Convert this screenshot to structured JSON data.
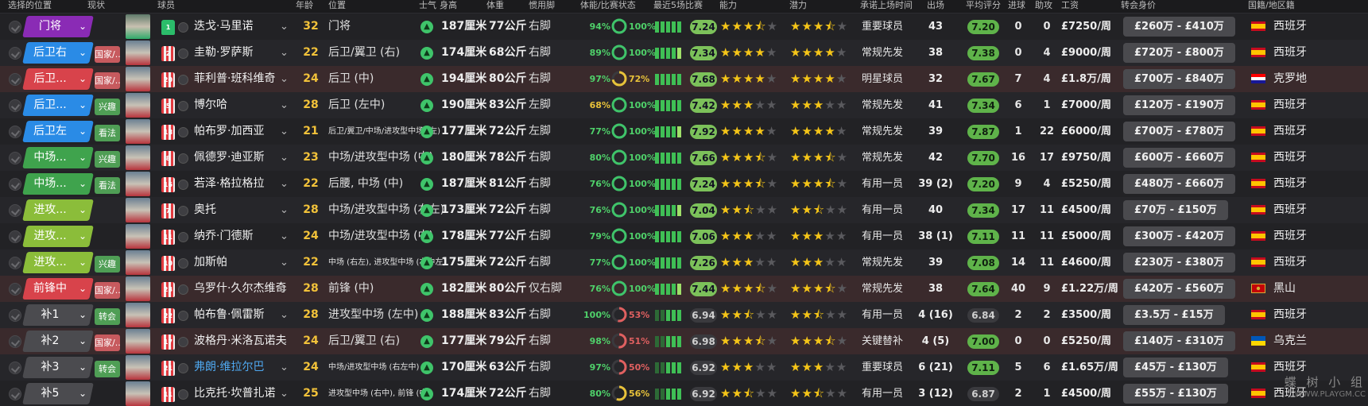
{
  "header": {
    "cols": [
      "选择的位置",
      "现状",
      "球员",
      "年龄",
      "位置",
      "士气",
      "身高",
      "体重",
      "惯用脚",
      "体能/比赛状态",
      "最近5场比赛",
      "能力",
      "潜力",
      "承诺上场时间",
      "出场",
      "平均评分",
      "进球",
      "助攻",
      "工资",
      "转会身价",
      "国籍/地区籍"
    ]
  },
  "rows": [
    {
      "pos": "门将",
      "pc": "gk",
      "role": "",
      "rc": "",
      "name": "迭戈·马里诺",
      "shirt": "1",
      "age": "32",
      "ppos": "门将",
      "psm": false,
      "height": "187厘米",
      "weight": "77公斤",
      "foot": "右脚",
      "fit": "94%",
      "fit_y": false,
      "sharp": "100%",
      "sharp_c": "g",
      "ring": 1.0,
      "rcol": "#3fc46a",
      "rating": "7.24",
      "rgrey": false,
      "ability": 3.5,
      "potential": 3.5,
      "status": "重要球员",
      "apps": "43",
      "avg": "7.20",
      "agrey": false,
      "goals": "0",
      "assists": "0",
      "wage": "£7250/周",
      "value": "£260万 - £410万",
      "flag": "es",
      "nat": "西班牙"
    },
    {
      "pos": "后卫右",
      "pc": "def",
      "role": "国家/...",
      "rc": "red",
      "name": "圭勒·罗萨斯",
      "shirt": "2",
      "age": "22",
      "ppos": "后卫/翼卫 (右)",
      "psm": false,
      "height": "174厘米",
      "weight": "68公斤",
      "foot": "右脚",
      "fit": "89%",
      "fit_y": false,
      "sharp": "100%",
      "sharp_c": "g",
      "ring": 1.0,
      "rcol": "#3fc46a",
      "rating": "7.34",
      "rgrey": false,
      "ability": 4,
      "potential": 4,
      "status": "常规先发",
      "apps": "38",
      "avg": "7.38",
      "agrey": false,
      "goals": "0",
      "assists": "4",
      "wage": "£9000/周",
      "value": "£720万 - £800万",
      "flag": "es",
      "nat": "西班牙"
    },
    {
      "pos": "后卫...",
      "pc": "st",
      "role": "国家/...",
      "rc": "red",
      "name": "菲利普·班科维奇",
      "shirt": "20",
      "age": "24",
      "ppos": "后卫 (中)",
      "psm": false,
      "height": "194厘米",
      "weight": "80公斤",
      "foot": "右脚",
      "fit": "97%",
      "fit_y": false,
      "sharp": "72%",
      "sharp_c": "y",
      "ring": 0.72,
      "rcol": "#e8c23a",
      "rating": "7.68",
      "rgrey": false,
      "ability": 4,
      "potential": 4,
      "status": "明星球员",
      "apps": "32",
      "avg": "7.67",
      "agrey": false,
      "goals": "7",
      "assists": "4",
      "wage": "£1.8万/周",
      "value": "£700万 - £840万",
      "flag": "hr",
      "nat": "克罗地"
    },
    {
      "pos": "后卫...",
      "pc": "def",
      "role": "兴趣",
      "rc": "green",
      "name": "博尔哈",
      "shirt": "5",
      "age": "28",
      "ppos": "后卫 (左中)",
      "psm": false,
      "height": "190厘米",
      "weight": "83公斤",
      "foot": "左脚",
      "fit": "68%",
      "fit_y": true,
      "sharp": "100%",
      "sharp_c": "g",
      "ring": 1.0,
      "rcol": "#3fc46a",
      "rating": "7.42",
      "rgrey": false,
      "ability": 3,
      "potential": 3,
      "status": "常规先发",
      "apps": "41",
      "avg": "7.34",
      "agrey": false,
      "goals": "6",
      "assists": "1",
      "wage": "£7000/周",
      "value": "£120万 - £190万",
      "flag": "es",
      "nat": "西班牙"
    },
    {
      "pos": "后卫左",
      "pc": "def",
      "role": "看法",
      "rc": "green",
      "name": "帕布罗·加西亚",
      "shirt": "18",
      "age": "21",
      "ppos": "后卫/翼卫/中场/进攻型中场 (左)",
      "psm": true,
      "height": "177厘米",
      "weight": "72公斤",
      "foot": "左脚",
      "fit": "77%",
      "fit_y": false,
      "sharp": "100%",
      "sharp_c": "g",
      "ring": 1.0,
      "rcol": "#3fc46a",
      "rating": "7.92",
      "rgrey": false,
      "ability": 4,
      "potential": 4,
      "status": "常规先发",
      "apps": "39",
      "avg": "7.87",
      "agrey": false,
      "goals": "1",
      "assists": "22",
      "wage": "£6000/周",
      "value": "£700万 - £780万",
      "flag": "es",
      "nat": "西班牙"
    },
    {
      "pos": "中场...",
      "pc": "mid",
      "role": "兴趣",
      "rc": "green",
      "name": "佩德罗·迪亚斯",
      "shirt": "8",
      "age": "23",
      "ppos": "中场/进攻型中场 (中)",
      "psm": false,
      "height": "180厘米",
      "weight": "78公斤",
      "foot": "右脚",
      "fit": "80%",
      "fit_y": false,
      "sharp": "100%",
      "sharp_c": "g",
      "ring": 1.0,
      "rcol": "#3fc46a",
      "rating": "7.66",
      "rgrey": false,
      "ability": 3.5,
      "potential": 3.5,
      "status": "常规先发",
      "apps": "42",
      "avg": "7.70",
      "agrey": false,
      "goals": "16",
      "assists": "17",
      "wage": "£9750/周",
      "value": "£600万 - £660万",
      "flag": "es",
      "nat": "西班牙"
    },
    {
      "pos": "中场...",
      "pc": "mid",
      "role": "看法",
      "rc": "green",
      "name": "若泽·格拉格拉",
      "shirt": "16",
      "age": "22",
      "ppos": "后腰, 中场 (中)",
      "psm": false,
      "height": "187厘米",
      "weight": "81公斤",
      "foot": "右脚",
      "fit": "76%",
      "fit_y": false,
      "sharp": "100%",
      "sharp_c": "g",
      "ring": 1.0,
      "rcol": "#3fc46a",
      "rating": "7.24",
      "rgrey": false,
      "ability": 3.5,
      "potential": 3.5,
      "status": "有用一员",
      "apps": "39 (2)",
      "avg": "7.20",
      "agrey": false,
      "goals": "9",
      "assists": "4",
      "wage": "£5250/周",
      "value": "£480万 - £660万",
      "flag": "es",
      "nat": "西班牙"
    },
    {
      "pos": "进攻...",
      "pc": "am",
      "role": "",
      "rc": "",
      "name": "奥托",
      "shirt": "7",
      "age": "28",
      "ppos": "中场/进攻型中场 (右左)",
      "psm": false,
      "height": "173厘米",
      "weight": "72公斤",
      "foot": "右脚",
      "fit": "76%",
      "fit_y": false,
      "sharp": "100%",
      "sharp_c": "g",
      "ring": 1.0,
      "rcol": "#3fc46a",
      "rating": "7.04",
      "rgrey": false,
      "ability": 2.5,
      "potential": 2.5,
      "status": "有用一员",
      "apps": "40",
      "avg": "7.34",
      "agrey": false,
      "goals": "17",
      "assists": "11",
      "wage": "£4500/周",
      "value": "£70万 - £150万",
      "flag": "es",
      "nat": "西班牙"
    },
    {
      "pos": "进攻...",
      "pc": "am",
      "role": "",
      "rc": "",
      "name": "纳乔·门德斯",
      "shirt": "11",
      "age": "24",
      "ppos": "中场/进攻型中场 (中)",
      "psm": false,
      "height": "178厘米",
      "weight": "77公斤",
      "foot": "右脚",
      "fit": "79%",
      "fit_y": false,
      "sharp": "100%",
      "sharp_c": "g",
      "ring": 1.0,
      "rcol": "#3fc46a",
      "rating": "7.06",
      "rgrey": false,
      "ability": 3,
      "potential": 3,
      "status": "有用一员",
      "apps": "38 (1)",
      "avg": "7.11",
      "agrey": false,
      "goals": "11",
      "assists": "11",
      "wage": "£5000/周",
      "value": "£300万 - £420万",
      "flag": "es",
      "nat": "西班牙"
    },
    {
      "pos": "进攻...",
      "pc": "am",
      "role": "兴趣",
      "rc": "green",
      "name": "加斯帕",
      "shirt": "10",
      "age": "22",
      "ppos": "中场 (右左), 进攻型中场 (右中左)",
      "psm": true,
      "height": "175厘米",
      "weight": "72公斤",
      "foot": "右脚",
      "fit": "77%",
      "fit_y": false,
      "sharp": "100%",
      "sharp_c": "g",
      "ring": 1.0,
      "rcol": "#3fc46a",
      "rating": "7.26",
      "rgrey": false,
      "ability": 3,
      "potential": 3,
      "status": "常规先发",
      "apps": "39",
      "avg": "7.08",
      "agrey": false,
      "goals": "14",
      "assists": "11",
      "wage": "£4600/周",
      "value": "£230万 - £380万",
      "flag": "es",
      "nat": "西班牙"
    },
    {
      "pos": "前锋中",
      "pc": "st",
      "role": "国家/...",
      "rc": "red",
      "name": "乌罗什·久尔杰维奇",
      "shirt": "23",
      "age": "28",
      "ppos": "前锋 (中)",
      "psm": false,
      "height": "182厘米",
      "weight": "80公斤",
      "foot": "仅右脚",
      "fit": "76%",
      "fit_y": false,
      "sharp": "100%",
      "sharp_c": "g",
      "ring": 1.0,
      "rcol": "#3fc46a",
      "rating": "7.44",
      "rgrey": false,
      "ability": 3.5,
      "potential": 3.5,
      "status": "常规先发",
      "apps": "38",
      "avg": "7.64",
      "agrey": false,
      "goals": "40",
      "assists": "9",
      "wage": "£1.22万/周",
      "value": "£420万 - £560万",
      "flag": "me",
      "nat": "黑山"
    },
    {
      "pos": "补1",
      "pc": "sub",
      "role": "转会",
      "rc": "green",
      "name": "帕布鲁·佩雷斯",
      "shirt": "22",
      "age": "28",
      "ppos": "进攻型中场 (左中)",
      "psm": false,
      "height": "188厘米",
      "weight": "83公斤",
      "foot": "右脚",
      "fit": "100%",
      "fit_y": false,
      "sharp": "53%",
      "sharp_c": "r",
      "ring": 0.53,
      "rcol": "#e06060",
      "rating": "6.94",
      "rgrey": true,
      "ability": 2.5,
      "potential": 2.5,
      "status": "有用一员",
      "apps": "4 (16)",
      "avg": "6.84",
      "agrey": true,
      "goals": "2",
      "assists": "2",
      "wage": "£3500/周",
      "value": "£3.5万 - £15万",
      "flag": "es",
      "nat": "西班牙"
    },
    {
      "pos": "补2",
      "pc": "sub",
      "role": "国家/...",
      "rc": "red",
      "name": "波格丹·米洛瓦诺夫",
      "shirt": "17",
      "age": "24",
      "ppos": "后卫/翼卫 (右)",
      "psm": false,
      "height": "177厘米",
      "weight": "79公斤",
      "foot": "右脚",
      "fit": "98%",
      "fit_y": false,
      "sharp": "51%",
      "sharp_c": "r",
      "ring": 0.51,
      "rcol": "#e06060",
      "rating": "6.98",
      "rgrey": true,
      "ability": 3.5,
      "potential": 3.5,
      "status": "关键替补",
      "apps": "4 (5)",
      "avg": "7.00",
      "agrey": false,
      "goals": "0",
      "assists": "0",
      "wage": "£5250/周",
      "value": "£140万 - £310万",
      "flag": "ua",
      "nat": "乌克兰"
    },
    {
      "pos": "补3",
      "pc": "sub",
      "role": "转会",
      "rc": "green",
      "name": "弗朗·维拉尔巴",
      "shirt": "21",
      "age": "24",
      "ppos": "中场/进攻型中场 (右左中)",
      "psm": true,
      "height": "170厘米",
      "weight": "63公斤",
      "foot": "右脚",
      "fit": "97%",
      "fit_y": false,
      "sharp": "50%",
      "sharp_c": "r",
      "ring": 0.5,
      "rcol": "#e06060",
      "rating": "6.92",
      "rgrey": true,
      "ability": 3,
      "potential": 3,
      "status": "重要球员",
      "apps": "6 (21)",
      "avg": "7.11",
      "agrey": false,
      "goals": "5",
      "assists": "6",
      "wage": "£1.65万/周",
      "value": "£45万 - £130万",
      "flag": "es",
      "nat": "西班牙",
      "blue": true
    },
    {
      "pos": "补5",
      "pc": "sub",
      "role": "",
      "rc": "",
      "name": "比克托·坎普扎诺",
      "shirt": "11",
      "age": "25",
      "ppos": "进攻型中场 (右中), 前锋 (中)",
      "psm": true,
      "height": "174厘米",
      "weight": "72公斤",
      "foot": "右脚",
      "fit": "80%",
      "fit_y": false,
      "sharp": "56%",
      "sharp_c": "y",
      "ring": 0.56,
      "rcol": "#e8c23a",
      "rating": "6.92",
      "rgrey": true,
      "ability": 2.5,
      "potential": 2.5,
      "status": "有用一员",
      "apps": "3 (12)",
      "avg": "6.87",
      "agrey": true,
      "goals": "2",
      "assists": "1",
      "wage": "£4500/周",
      "value": "£55万 - £130万",
      "flag": "es",
      "nat": "西班牙"
    }
  ],
  "watermark": {
    "line1": "蝶 树 小 组",
    "line2": "WWW.PLAYGM.CC"
  }
}
